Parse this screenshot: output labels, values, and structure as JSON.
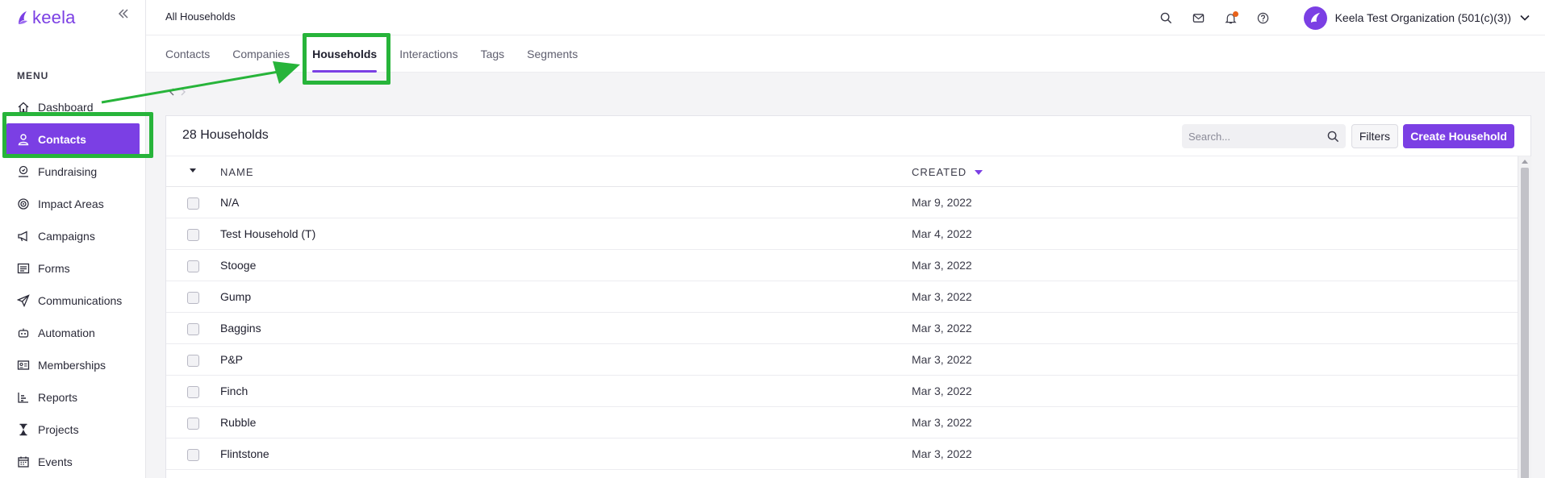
{
  "brand": {
    "name": "keela",
    "color": "#7b3fe4"
  },
  "sidebar": {
    "collapse_icon": "double-chevron-left",
    "menu_title": "MENU",
    "items": [
      {
        "label": "Dashboard",
        "icon": "home-icon"
      },
      {
        "label": "Contacts",
        "icon": "person-icon",
        "active": true
      },
      {
        "label": "Fundraising",
        "icon": "donation-icon"
      },
      {
        "label": "Impact Areas",
        "icon": "target-icon"
      },
      {
        "label": "Campaigns",
        "icon": "megaphone-icon"
      },
      {
        "label": "Forms",
        "icon": "form-icon"
      },
      {
        "label": "Communications",
        "icon": "paper-plane-icon"
      },
      {
        "label": "Automation",
        "icon": "robot-icon"
      },
      {
        "label": "Memberships",
        "icon": "id-card-icon"
      },
      {
        "label": "Reports",
        "icon": "bar-chart-icon"
      },
      {
        "label": "Projects",
        "icon": "hourglass-icon"
      },
      {
        "label": "Events",
        "icon": "calendar-icon"
      }
    ]
  },
  "header": {
    "page_title": "All Households",
    "org_name": "Keela Test Organization (501(c)(3))",
    "notification_color": "#e8621b"
  },
  "tabs": [
    {
      "label": "Contacts"
    },
    {
      "label": "Companies"
    },
    {
      "label": "Households",
      "active": true
    },
    {
      "label": "Interactions"
    },
    {
      "label": "Tags"
    },
    {
      "label": "Segments"
    }
  ],
  "list": {
    "title": "28 Households",
    "search_placeholder": "Search...",
    "filters_label": "Filters",
    "create_label": "Create Household",
    "columns": {
      "name": "NAME",
      "created": "CREATED"
    },
    "rows": [
      {
        "name": "N/A",
        "created": "Mar 9, 2022"
      },
      {
        "name": "Test Household (T)",
        "created": "Mar 4, 2022"
      },
      {
        "name": "Stooge",
        "created": "Mar 3, 2022"
      },
      {
        "name": "Gump",
        "created": "Mar 3, 2022"
      },
      {
        "name": "Baggins",
        "created": "Mar 3, 2022"
      },
      {
        "name": "P&P",
        "created": "Mar 3, 2022"
      },
      {
        "name": "Finch",
        "created": "Mar 3, 2022"
      },
      {
        "name": "Rubble",
        "created": "Mar 3, 2022"
      },
      {
        "name": "Flintstone",
        "created": "Mar 3, 2022"
      }
    ]
  },
  "annotation": {
    "highlight_color": "#27b43a"
  }
}
